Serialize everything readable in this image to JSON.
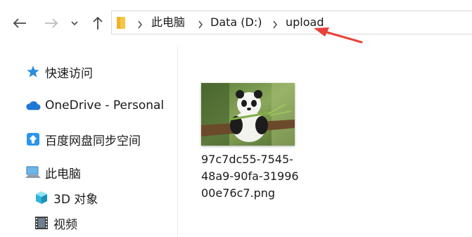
{
  "nav": {
    "back_icon": "arrow-left-icon",
    "forward_icon": "arrow-right-icon",
    "recent_icon": "chevron-down-icon",
    "up_icon": "arrow-up-icon"
  },
  "breadcrumb": {
    "items": [
      {
        "label": "此电脑"
      },
      {
        "label": "Data (D:)"
      },
      {
        "label": "upload"
      }
    ]
  },
  "annotation": {
    "color": "#e8413a"
  },
  "sidebar": {
    "items": [
      {
        "label": "快速访问",
        "icon": "star-icon"
      },
      {
        "label": "OneDrive - Personal",
        "icon": "cloud-icon"
      },
      {
        "label": "百度网盘同步空间",
        "icon": "baidu-netdisk-icon"
      },
      {
        "label": "此电脑",
        "icon": "computer-icon"
      },
      {
        "label": "3D 对象",
        "icon": "cube-3d-icon"
      },
      {
        "label": "视频",
        "icon": "film-icon"
      }
    ]
  },
  "content": {
    "file": {
      "name": "97c7dc55-7545-48a9-90fa-3199600e76c7.png",
      "thumbnail_icon": "panda-thumbnail"
    }
  }
}
